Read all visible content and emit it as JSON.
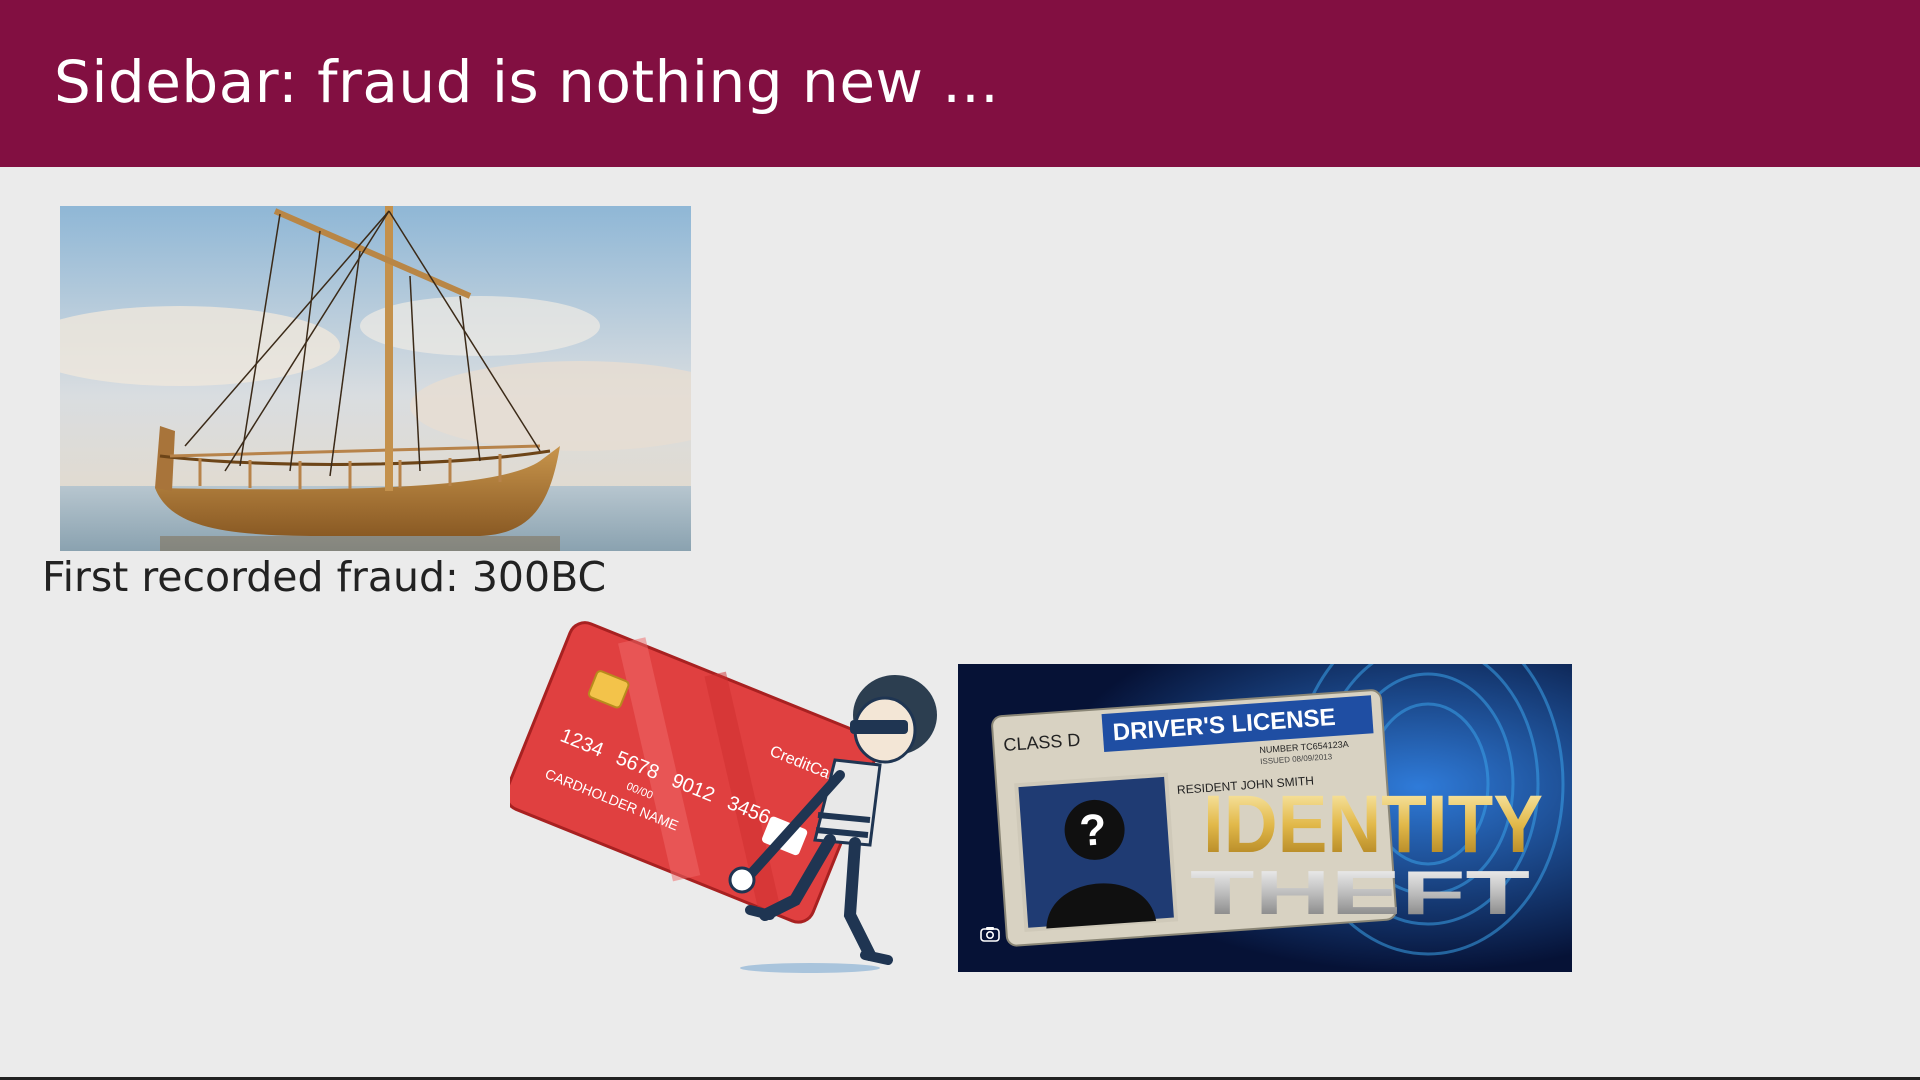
{
  "slide": {
    "title": "Sidebar: fraud is nothing new ...",
    "caption": "First recorded fraud: 300BC"
  },
  "credit_card": {
    "brand": "CreditCard",
    "number_groups": [
      "1234",
      "5678",
      "9012",
      "3456"
    ],
    "expiry": "00/00",
    "holder": "CARDHOLDER NAME"
  },
  "license": {
    "class": "CLASS D",
    "header": "DRIVER'S LICENSE",
    "number": "NUMBER TC654123A",
    "issued": "ISSUED 08/09/2013",
    "resident": "RESIDENT JOHN SMITH",
    "headline_line1": "IDENTITY",
    "headline_line2": "THEFT"
  },
  "icons": {
    "camera": "camera-icon",
    "question_mark": "?"
  },
  "colors": {
    "title_bar": "#820f41",
    "background": "#ebebeb",
    "card_red": "#e23c3c",
    "license_blue": "#1f4ea3"
  }
}
